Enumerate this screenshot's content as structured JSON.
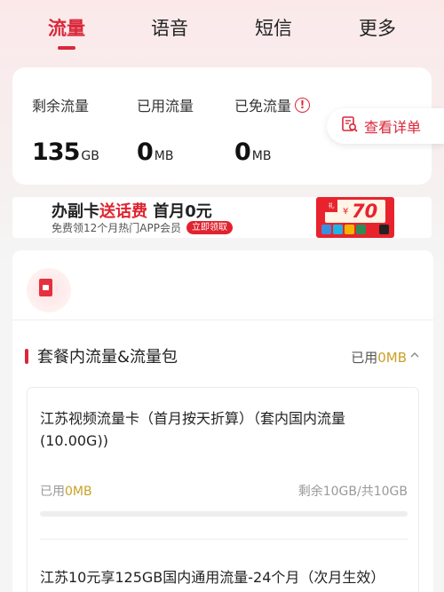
{
  "tabs": [
    {
      "label": "流量",
      "active": true
    },
    {
      "label": "语音",
      "active": false
    },
    {
      "label": "短信",
      "active": false
    },
    {
      "label": "更多",
      "active": false
    }
  ],
  "summary": {
    "remaining": {
      "label": "剩余流量",
      "value": "135",
      "unit": "GB"
    },
    "used": {
      "label": "已用流量",
      "value": "0",
      "unit": "MB"
    },
    "free": {
      "label": "已免流量",
      "value": "0",
      "unit": "MB"
    },
    "detail_button": "查看详单"
  },
  "banner": {
    "title_part1": "办副卡",
    "title_highlight": "送话费",
    "title_part2": " 首月0元",
    "subtitle": "免费领12个月热门APP会员",
    "cta": "立即领取",
    "coupon_symbol": "¥",
    "coupon_value": "70",
    "coupon_badge": "礼"
  },
  "section": {
    "title": "套餐内流量&流量包",
    "used_prefix": "已用",
    "used_value": "0MB"
  },
  "packages": [
    {
      "name": "江苏视频流量卡（首月按天折算）（套内国内流量(10.00G))",
      "used_prefix": "已用",
      "used_value": "0MB",
      "remaining": "剩余10GB/共10GB",
      "used_fraction": 0
    },
    {
      "name": "江苏10元享125GB国内通用流量-24个月（次月生效）"
    }
  ],
  "colors": {
    "accent": "#d9283a",
    "gold": "#c9a227",
    "coupon_dots": [
      "#3b8fe0",
      "#1fb3e8",
      "#f5b400",
      "#2e8b57",
      "#e8232d",
      "#222222"
    ]
  }
}
